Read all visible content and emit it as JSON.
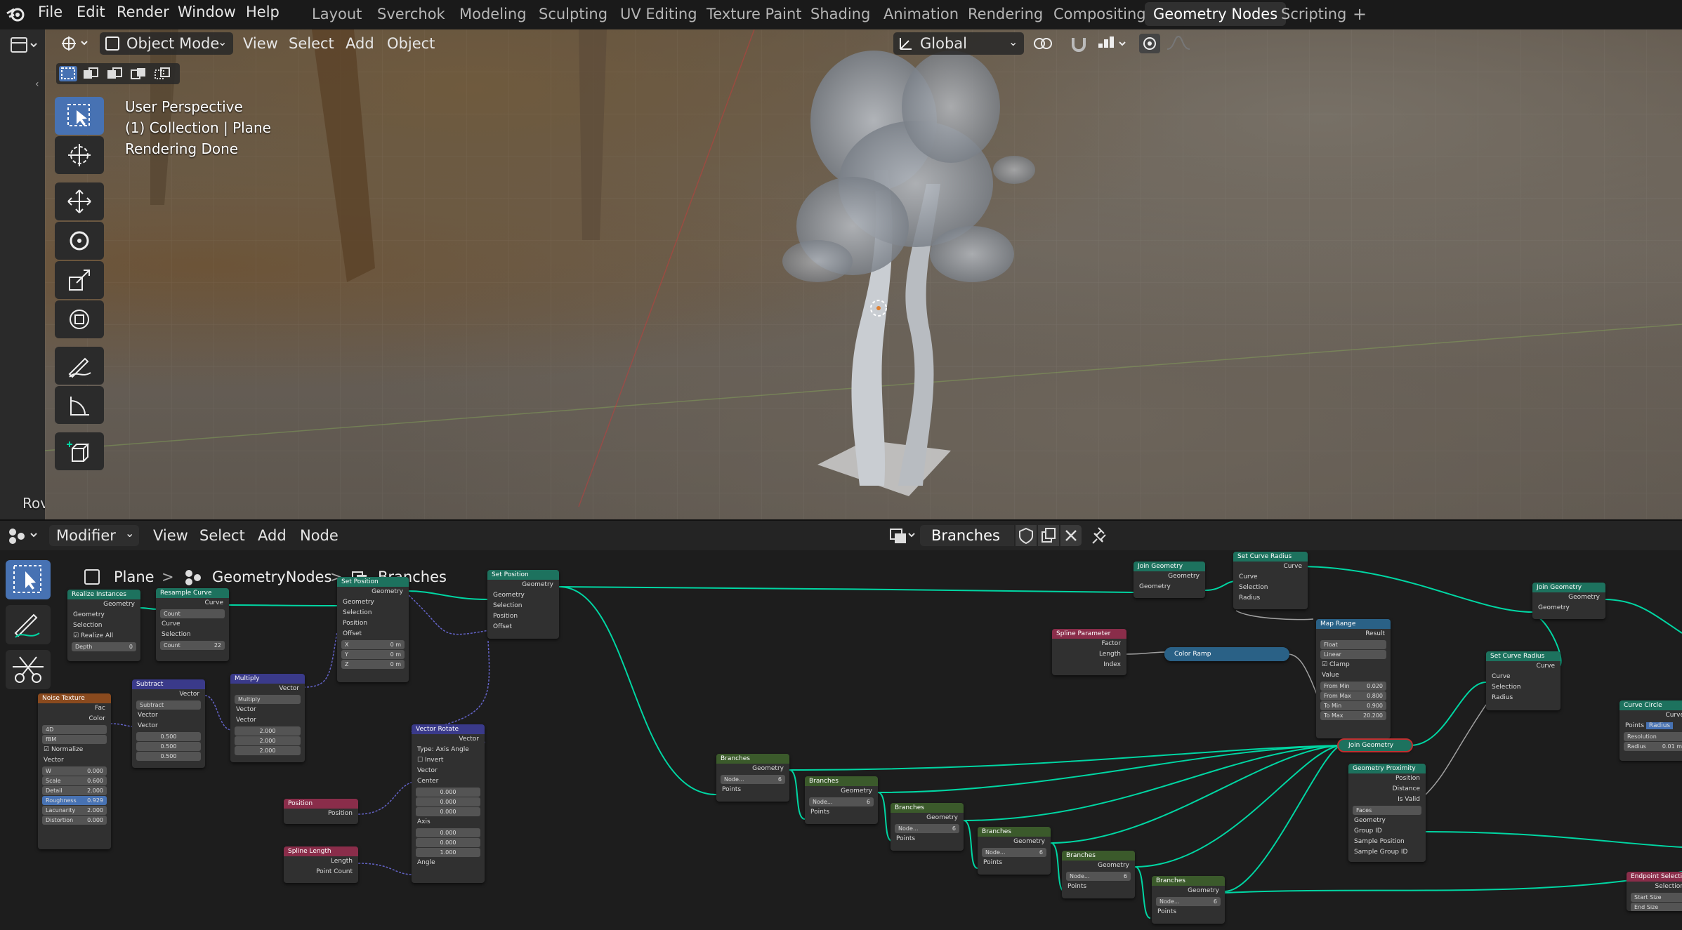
{
  "menubar": {
    "items": [
      "File",
      "Edit",
      "Render",
      "Window",
      "Help"
    ]
  },
  "workspaces": {
    "tabs": [
      "Layout",
      "Sverchok",
      "Modeling",
      "Sculpting",
      "UV Editing",
      "Texture Paint",
      "Shading",
      "Animation",
      "Rendering",
      "Compositing",
      "Geometry Nodes",
      "Scripting"
    ],
    "active": "Geometry Nodes",
    "add": "+"
  },
  "viewport_header": {
    "mode": "Object Mode",
    "menus": [
      "View",
      "Select",
      "Add",
      "Object"
    ],
    "orientation": "Global"
  },
  "viewport_overlay": {
    "line1": "User Perspective",
    "line2": "(1) Collection | Plane",
    "line3": "Rendering Done"
  },
  "left_cut_text": "Rov",
  "node_header": {
    "editor": "Modifier",
    "menus": [
      "View",
      "Select",
      "Add",
      "Node"
    ],
    "node_group": "Branches"
  },
  "breadcrumb": {
    "object": "Plane",
    "modifier": "GeometryNodes",
    "group": "Branches",
    "sep": ">"
  },
  "nodes": {
    "realize": {
      "title": "Realize Instances",
      "out": "Geometry",
      "in1": "Geometry",
      "in2": "Selection",
      "check": "Realize All",
      "field_label": "Depth",
      "field_val": "0"
    },
    "resample": {
      "title": "Resample Curve",
      "out": "Curve",
      "mode": "Count",
      "in1": "Curve",
      "in2": "Selection",
      "field_label": "Count",
      "field_val": "22"
    },
    "setpos1": {
      "title": "Set Position",
      "out": "Geometry",
      "in1": "Geometry",
      "in2": "Selection",
      "in3": "Position",
      "in4": "Offset",
      "x": "X",
      "y": "Y",
      "z": "Z",
      "xv": "0 m",
      "yv": "0 m",
      "zv": "0 m"
    },
    "setpos2": {
      "title": "Set Position",
      "out": "Geometry",
      "in1": "Geometry",
      "in2": "Selection",
      "in3": "Position",
      "in4": "Offset"
    },
    "noise": {
      "title": "Noise Texture",
      "out1": "Fac",
      "out2": "Color",
      "dim": "4D",
      "type": "fBM",
      "check": "Normalize",
      "in_vec": "Vector",
      "w": "W",
      "wv": "0.000",
      "scale": "Scale",
      "scalev": "0.600",
      "detail": "Detail",
      "detailv": "2.000",
      "rough": "Roughness",
      "roughv": "0.929",
      "lac": "Lacunarity",
      "lacv": "2.000",
      "dist": "Distortion",
      "distv": "0.000"
    },
    "subtract": {
      "title": "Subtract",
      "out": "Vector",
      "op": "Subtract",
      "in1": "Vector",
      "in2": "Vector",
      "v1": "0.500",
      "v2": "0.500",
      "v3": "0.500"
    },
    "multiply": {
      "title": "Multiply",
      "out": "Vector",
      "op": "Multiply",
      "in1": "Vector",
      "in2": "Vector",
      "v1": "2.000",
      "v2": "2.000",
      "v3": "2.000"
    },
    "vrotate": {
      "title": "Vector Rotate",
      "out": "Vector",
      "type_label": "Type:",
      "type_val": "Axis Angle",
      "check": "Invert",
      "in1": "Vector",
      "in2": "Center",
      "c1": "0.000",
      "c2": "0.000",
      "c3": "0.000",
      "in3": "Axis",
      "a1": "0.000",
      "a2": "0.000",
      "a3": "1.000",
      "in4": "Angle"
    },
    "position": {
      "title": "Position",
      "out": "Position"
    },
    "splinelen": {
      "title": "Spline Length",
      "out1": "Length",
      "out2": "Point Count"
    },
    "join1": {
      "title": "Join Geometry",
      "out": "Geometry",
      "in": "Geometry"
    },
    "setcr1": {
      "title": "Set Curve Radius",
      "out": "Curve",
      "in1": "Curve",
      "in2": "Selection",
      "in3": "Radius"
    },
    "join2": {
      "title": "Join Geometry",
      "out": "Geometry",
      "in": "Geometry"
    },
    "splineparam": {
      "title": "Spline Parameter",
      "out1": "Factor",
      "out2": "Length",
      "out3": "Index"
    },
    "colorramp": {
      "title": "Color Ramp"
    },
    "maprange": {
      "title": "Map Range",
      "out": "Result",
      "dtype": "Float",
      "interp": "Linear",
      "check": "Clamp",
      "in": "Value",
      "fmin": "From Min",
      "fminv": "0.020",
      "fmax": "From Max",
      "fmaxv": "0.800",
      "tmin": "To Min",
      "tminv": "0.900",
      "tmax": "To Max",
      "tmaxv": "20.200"
    },
    "setcr2": {
      "title": "Set Curve Radius",
      "out": "Curve",
      "in1": "Curve",
      "in2": "Selection",
      "in3": "Radius"
    },
    "joinred": {
      "title": "Join Geometry"
    },
    "proximity": {
      "title": "Geometry Proximity",
      "out1": "Position",
      "out2": "Distance",
      "out3": "Is Valid",
      "mode": "Faces",
      "in1": "Geometry",
      "in2": "Group ID",
      "in3": "Sample Position",
      "in4": "Sample Group ID"
    },
    "curvecircle": {
      "title": "Curve Circle",
      "out": "Curve",
      "mode1": "Points",
      "mode2": "Radius",
      "res": "Resolution",
      "radius": "Radius",
      "radv": "0.01 m"
    },
    "endpoint": {
      "title": "Endpoint Selection",
      "out": "Selection",
      "in1": "Start Size",
      "in2": "End Size"
    },
    "branches": {
      "title": "Branches",
      "out": "Geometry",
      "sub": "Node...",
      "num": "6",
      "in": "Points"
    }
  }
}
